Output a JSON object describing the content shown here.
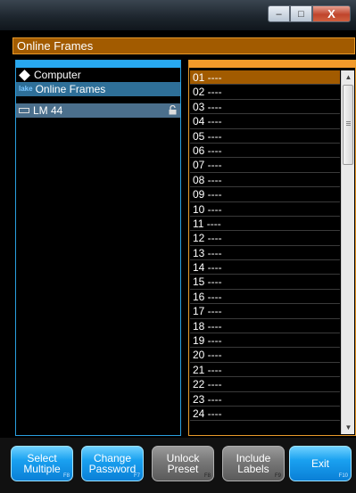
{
  "window": {
    "min_label": "–",
    "max_label": "□",
    "close_label": "X"
  },
  "header": {
    "title": "Online Frames"
  },
  "tree": {
    "computer": "Computer",
    "online_frames": "Online Frames",
    "frame": "LM 44"
  },
  "list": {
    "rows": [
      "01 ----",
      "02 ----",
      "03 ----",
      "04 ----",
      "05 ----",
      "06 ----",
      "07 ----",
      "08 ----",
      "09 ----",
      "10 ----",
      "11 ----",
      "12 ----",
      "13 ----",
      "14 ----",
      "15 ----",
      "16 ----",
      "17 ----",
      "18 ----",
      "19 ----",
      "20 ----",
      "21 ----",
      "22 ----",
      "23 ----",
      "24 ----"
    ],
    "selected_index": 0
  },
  "buttons": {
    "select_multiple": {
      "line1": "Select",
      "line2": "Multiple",
      "key": "F8"
    },
    "change_password": {
      "line1": "Change",
      "line2": "Password",
      "key": "F7"
    },
    "unlock_preset": {
      "line1": "Unlock",
      "line2": "Preset",
      "key": "F8"
    },
    "include_labels": {
      "line1": "Include",
      "line2": "Labels",
      "key": "F9"
    },
    "exit": {
      "label": "Exit",
      "key": "F10"
    }
  },
  "colors": {
    "accent_orange": "#a25b00",
    "accent_blue": "#28a8f0"
  }
}
